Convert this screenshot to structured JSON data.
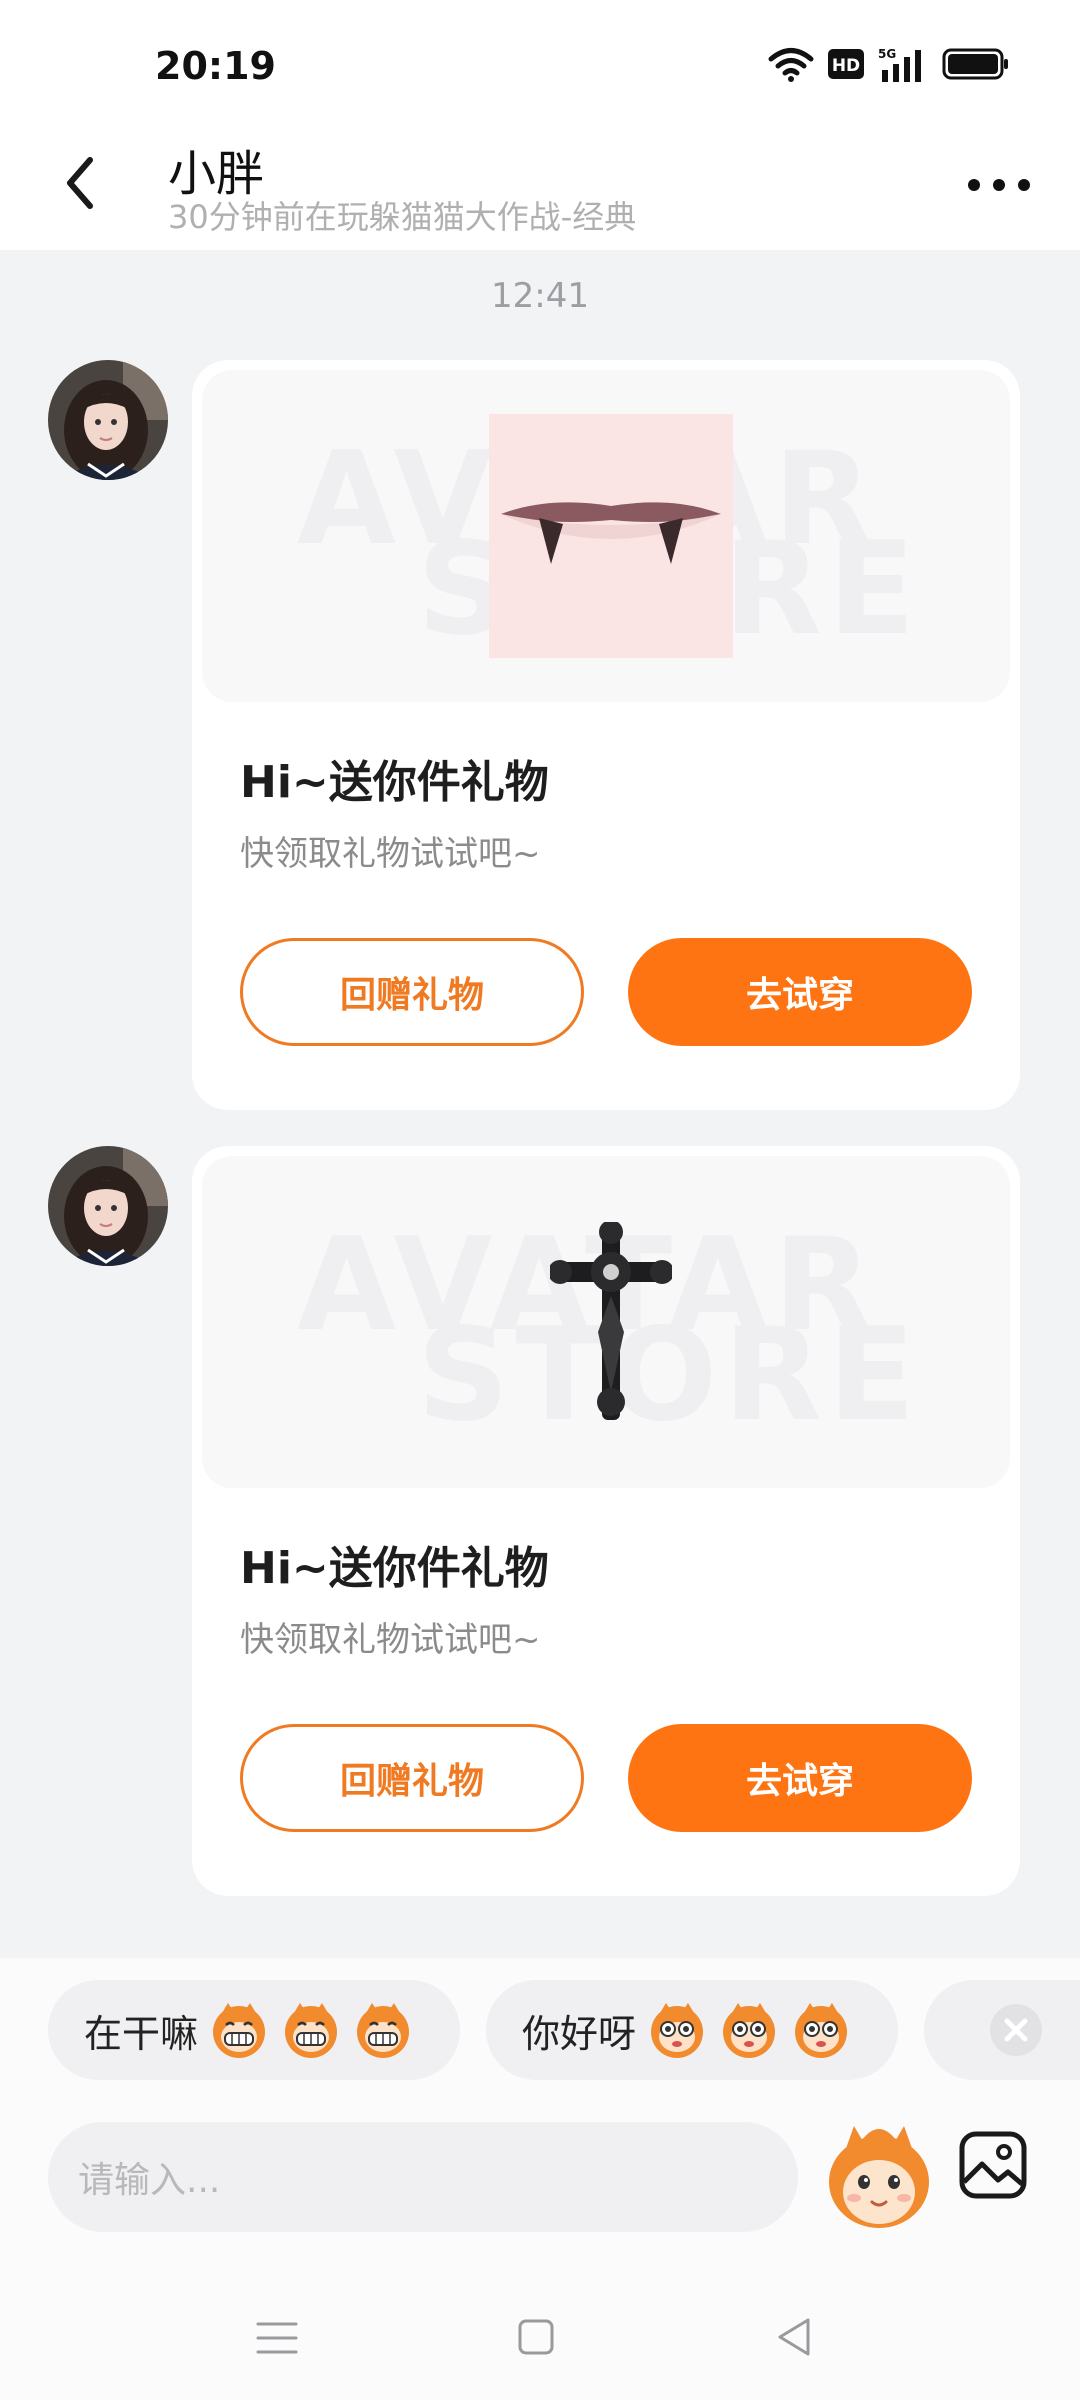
{
  "status_bar": {
    "time": "20:19",
    "icons": [
      "wifi-icon",
      "hd-icon",
      "5g-signal-icon",
      "battery-icon"
    ]
  },
  "header": {
    "name": "小胖",
    "presence": "30分钟前在玩躲猫猫大作战-经典",
    "back_icon": "back-arrow-icon",
    "more_icon": "more-dots-icon"
  },
  "chat": {
    "timestamp": "12:41",
    "messages": [
      {
        "gift_item": "vampire-fangs-mouth",
        "title": "Hi~送你件礼物",
        "subtitle": "快领取礼物试试吧~",
        "return_gift_label": "回赠礼物",
        "try_on_label": "去试穿"
      },
      {
        "gift_item": "gothic-cross-necklace",
        "title": "Hi~送你件礼物",
        "subtitle": "快领取礼物试试吧~",
        "return_gift_label": "回赠礼物",
        "try_on_label": "去试穿"
      }
    ]
  },
  "quick_replies": [
    {
      "text": "在干嘛",
      "emoji": "grin-monkey-emoji"
    },
    {
      "text": "你好呀",
      "emoji": "wide-eye-monkey-emoji"
    }
  ],
  "input": {
    "placeholder": "请输入..."
  },
  "colors": {
    "accent": "#ff7412",
    "background": "#f2f3f5"
  }
}
